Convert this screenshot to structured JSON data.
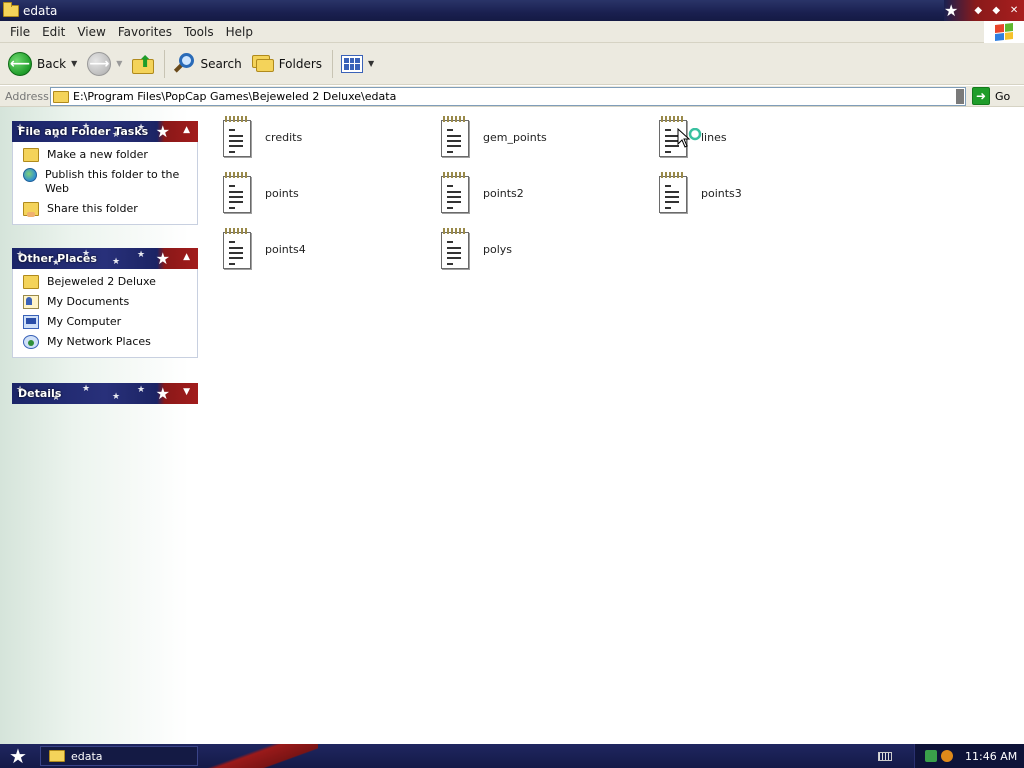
{
  "window": {
    "title": "edata"
  },
  "menu": [
    "File",
    "Edit",
    "View",
    "Favorites",
    "Tools",
    "Help"
  ],
  "toolbar": {
    "back": "Back",
    "search": "Search",
    "folders": "Folders"
  },
  "address": {
    "label": "Address",
    "path": "E:\\Program Files\\PopCap Games\\Bejeweled 2 Deluxe\\edata",
    "go": "Go"
  },
  "panels": {
    "tasks": {
      "title": "File and Folder Tasks",
      "items": [
        "Make a new folder",
        "Publish this folder to the Web",
        "Share this folder"
      ]
    },
    "places": {
      "title": "Other Places",
      "items": [
        "Bejeweled 2 Deluxe",
        "My Documents",
        "My Computer",
        "My Network Places"
      ]
    },
    "details": {
      "title": "Details"
    }
  },
  "files": [
    "credits",
    "gem_points",
    "lines",
    "points",
    "points2",
    "points3",
    "points4",
    "polys"
  ],
  "taskbar": {
    "window_button": "edata",
    "clock": "11:46 AM"
  },
  "colors": {
    "titlebar": "#1a2050",
    "accent_red": "#a21c1c",
    "go_green": "#1f9d2a"
  }
}
